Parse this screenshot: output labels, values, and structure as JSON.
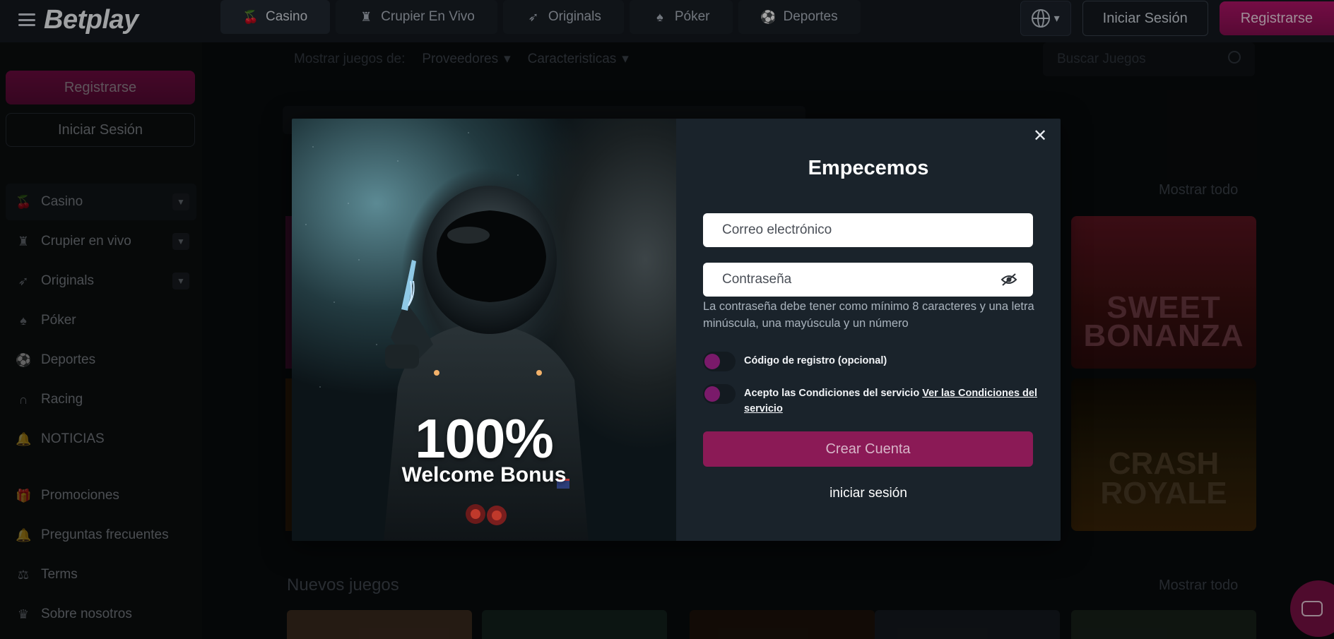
{
  "brand": {
    "logo_text": "Betplay",
    "accent": "#b3146a"
  },
  "topnav": {
    "items": [
      {
        "label": "Casino",
        "icon": "cherries-icon"
      },
      {
        "label": "Crupier En Vivo",
        "icon": "dealer-icon"
      },
      {
        "label": "Originals",
        "icon": "rocket-icon"
      },
      {
        "label": "Póker",
        "icon": "spade-icon"
      },
      {
        "label": "Deportes",
        "icon": "ball-icon"
      }
    ],
    "login_label": "Iniciar Sesión",
    "register_label": "Registrarse"
  },
  "sidebar": {
    "register_label": "Registrarse",
    "login_label": "Iniciar Sesión",
    "items": [
      {
        "label": "Casino",
        "icon": "cherries-icon"
      },
      {
        "label": "Crupier en vivo",
        "icon": "dealer-icon"
      },
      {
        "label": "Originals",
        "icon": "rocket-icon"
      },
      {
        "label": "Póker",
        "icon": "spade-icon"
      },
      {
        "label": "Deportes",
        "icon": "ball-icon"
      },
      {
        "label": "Racing",
        "icon": "horseshoe-icon"
      },
      {
        "label": "NOTICIAS",
        "icon": "bell-icon"
      }
    ],
    "items2": [
      {
        "label": "Promociones",
        "icon": "gift-icon"
      },
      {
        "label": "Preguntas frecuentes",
        "icon": "bell-icon"
      },
      {
        "label": "Terms",
        "icon": "scale-icon"
      },
      {
        "label": "Sobre nosotros",
        "icon": "crown-icon"
      }
    ]
  },
  "main": {
    "filter_label": "Mostrar juegos de:",
    "providers_label": "Proveedores",
    "features_label": "Caracteristicas",
    "search_placeholder": "Buscar Juegos",
    "show_all_1": "Mostrar todo",
    "show_all_2": "Mostrar todo",
    "new_games_title": "Nuevos juegos",
    "tile_sweet": "SWEET BONANZA",
    "tile_crash": "CRASH ROYALE"
  },
  "modal": {
    "bonus_percent": "100%",
    "bonus_label": "Welcome Bonus",
    "title": "Empecemos",
    "email_placeholder": "Correo electrónico",
    "password_placeholder": "Contraseña",
    "password_hint": "La contraseña debe tener como mínimo 8 caracteres y una letra minúscula, una mayúscula y un número",
    "referral_label": "Código de registro (opcional)",
    "terms_label": "Acepto las Condiciones del servicio ",
    "terms_link": "Ver las Condiciones del servicio",
    "create_label": "Crear Cuenta",
    "login_link": "iniciar sesión"
  }
}
